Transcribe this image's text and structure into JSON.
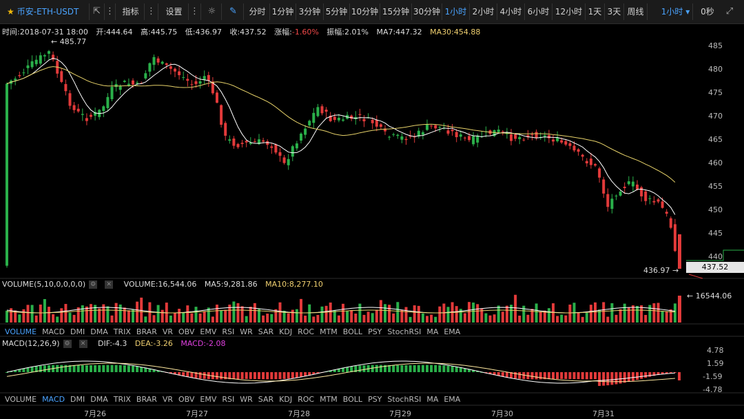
{
  "toolbar": {
    "symbol": "币安-ETH-USDT",
    "indicator_label": "指标",
    "settings_label": "设置",
    "intervals": [
      "分时",
      "1分钟",
      "3分钟",
      "5分钟",
      "10分钟",
      "15分钟",
      "30分钟",
      "1小时",
      "2小时",
      "4小时",
      "6小时",
      "12小时",
      "1天",
      "3天",
      "周线"
    ],
    "active_interval": "1小时",
    "dropdown_value": "1小时",
    "countdown": "0秒",
    "colors": {
      "accent": "#4aa3ff",
      "star": "#f0b90b"
    }
  },
  "info": {
    "time": "时间:2018-07-31 18:00",
    "open": "开:444.64",
    "high": "高:445.75",
    "low": "低:436.97",
    "close": "收:437.52",
    "change_label": "涨幅:",
    "change_value": "-1.60%",
    "amplitude": "振幅:2.01%",
    "ma7": "MA7:447.32",
    "ma30": "MA30:454.88"
  },
  "price_axis": {
    "ticks": [
      "485",
      "480",
      "475",
      "470",
      "465",
      "460",
      "455",
      "450",
      "445",
      "440"
    ],
    "max_label": "← 485.77",
    "min_label": "436.97 →",
    "current_price": "437.52"
  },
  "volume": {
    "header": "VOLUME(5,10,0,0,0,0)",
    "value": "VOLUME:16,544.06",
    "ma5": "MA5:9,281.86",
    "ma10": "MA10:8,277.10",
    "last_label": "← 16544.06"
  },
  "indicator_tabs": [
    "VOLUME",
    "MACD",
    "DMI",
    "DMA",
    "TRIX",
    "BRAR",
    "VR",
    "OBV",
    "EMV",
    "RSI",
    "WR",
    "SAR",
    "KDJ",
    "ROC",
    "MTM",
    "BOLL",
    "PSY",
    "StochRSI",
    "MA",
    "EMA"
  ],
  "macd": {
    "header": "MACD(12,26,9)",
    "dif": "DIF:-4.3",
    "dea": "DEA:-3.26",
    "macd": "MACD:-2.08",
    "ticks": [
      "4.78",
      "1.59",
      "-1.59",
      "-4.78"
    ]
  },
  "dates": [
    "7月26",
    "7月27",
    "7月28",
    "7月29",
    "7月30",
    "7月31"
  ],
  "colors": {
    "up": "#2ab04a",
    "down": "#e23a3a",
    "ma7": "#ffffff",
    "ma30": "#e8d36a",
    "dea": "#ffe9a0"
  }
}
